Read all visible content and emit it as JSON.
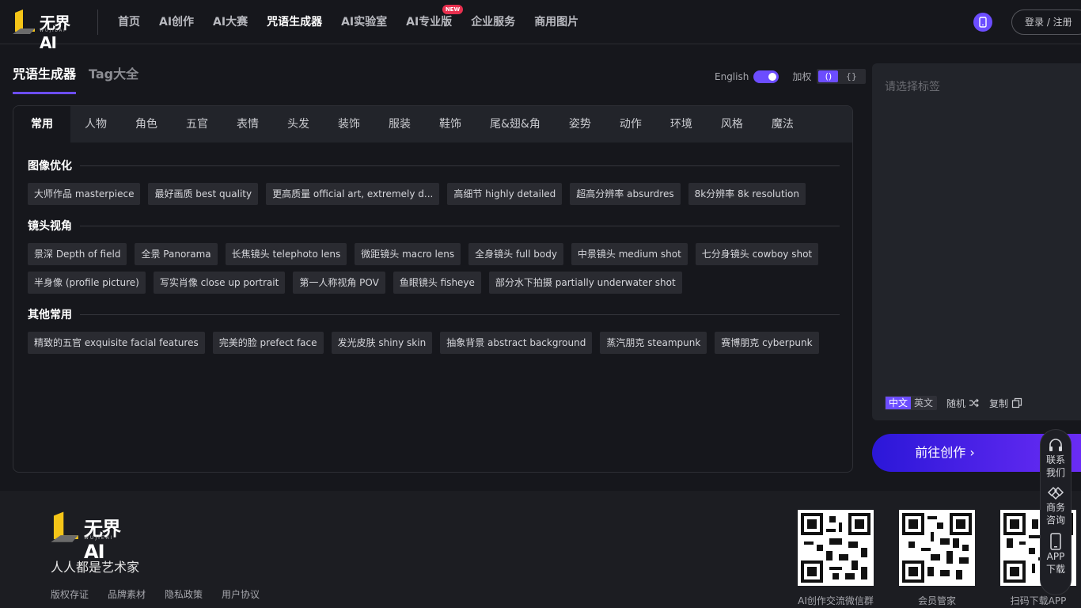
{
  "header": {
    "logo_text": "无界AI",
    "logo_sub": "WUJIEAI",
    "nav": [
      {
        "label": "首页",
        "active": false
      },
      {
        "label": "AI创作",
        "active": false
      },
      {
        "label": "AI大赛",
        "active": false
      },
      {
        "label": "咒语生成器",
        "active": true
      },
      {
        "label": "AI实验室",
        "active": false
      },
      {
        "label": "AI专业版",
        "active": false,
        "badge": "NEW"
      },
      {
        "label": "企业服务",
        "active": false
      },
      {
        "label": "商用图片",
        "active": false
      }
    ],
    "login_label": "登录 / 注册"
  },
  "page_tabs": [
    {
      "label": "咒语生成器",
      "active": true
    },
    {
      "label": "Tag大全",
      "active": false
    }
  ],
  "toggles": {
    "english_label": "English",
    "english_on": true,
    "weight_label": "加权",
    "weight_options": [
      "()",
      "{}"
    ],
    "weight_selected": "()"
  },
  "categories": [
    "常用",
    "人物",
    "角色",
    "五官",
    "表情",
    "头发",
    "装饰",
    "服装",
    "鞋饰",
    "尾&翅&角",
    "姿势",
    "动作",
    "环境",
    "风格",
    "魔法"
  ],
  "sections": [
    {
      "title": "图像优化",
      "rows": [
        [
          "大师作品 masterpiece",
          "最好画质 best quality",
          "更高质量 official art, extremely d...",
          "高细节 highly detailed",
          "超高分辨率 absurdres",
          "8k分辨率 8k resolution"
        ]
      ]
    },
    {
      "title": "镜头视角",
      "rows": [
        [
          "景深 Depth of field",
          "全景 Panorama",
          "长焦镜头 telephoto lens",
          "微距镜头 macro lens",
          "全身镜头 full body",
          "中景镜头 medium shot",
          "七分身镜头 cowboy shot"
        ],
        [
          "半身像 (profile picture)",
          "写实肖像 close up portrait",
          "第一人称视角 POV",
          "鱼眼镜头 fisheye",
          "部分水下拍摄 partially underwater shot"
        ]
      ]
    },
    {
      "title": "其他常用",
      "rows": [
        [
          "精致的五官 exquisite facial features",
          "完美的脸 prefect face",
          "发光皮肤 shiny skin",
          "抽象背景 abstract background",
          "蒸汽朋克 steampunk",
          "赛博朋克 cyberpunk"
        ]
      ]
    }
  ],
  "output": {
    "placeholder": "请选择标签",
    "lang_options": [
      "中文",
      "英文"
    ],
    "lang_selected": "中文",
    "random_label": "随机",
    "copy_label": "复制"
  },
  "create_label": "前往创作 ›",
  "float_bar": [
    {
      "label": "联系我们",
      "icon": "headset-icon"
    },
    {
      "label": "商务咨询",
      "icon": "handshake-icon"
    },
    {
      "label": "APP下载",
      "icon": "mobile-icon"
    }
  ],
  "footer": {
    "slogan": "人人都是艺术家",
    "links": [
      "版权存证",
      "品牌素材",
      "隐私政策",
      "用户协议"
    ],
    "qrcodes": [
      "AI创作交流微信群",
      "会员管家",
      "扫码下载APP"
    ]
  },
  "colors": {
    "accent": "#6c4dff",
    "badge": "#e8304f",
    "background": "#16171c"
  }
}
